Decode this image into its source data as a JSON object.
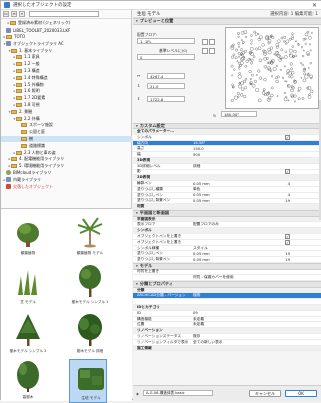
{
  "window": {
    "title": "選択したオブジェクトの設定",
    "close": "✕"
  },
  "toolbar": {
    "search_placeholder": ""
  },
  "tree": [
    {
      "label": "登録済み素材 (ジェネリック)",
      "indent": 6,
      "icon": "folder",
      "twist": "▸"
    },
    {
      "label": "LIBEL_TOOLBT_2020033.LKF",
      "indent": 2,
      "icon": "lib",
      "twist": ""
    },
    {
      "label": "TOTO",
      "indent": 2,
      "icon": "folder",
      "twist": "▸"
    },
    {
      "label": "オブジェクトライブラリ AC",
      "indent": 2,
      "icon": "lib",
      "twist": "▾"
    },
    {
      "label": "1. 基本ライブラリ",
      "indent": 7,
      "icon": "folder",
      "twist": "▾"
    },
    {
      "label": "1.1 家具",
      "indent": 12,
      "icon": "folder",
      "twist": "▸"
    },
    {
      "label": "1.2 一般",
      "indent": 12,
      "icon": "folder",
      "twist": "▸"
    },
    {
      "label": "1.3 構造",
      "indent": 12,
      "icon": "folder",
      "twist": "▸"
    },
    {
      "label": "1.4 特殊構造",
      "indent": 12,
      "icon": "folder",
      "twist": "▸"
    },
    {
      "label": "1.5 外構物",
      "indent": 12,
      "icon": "folder",
      "twist": "▸"
    },
    {
      "label": "1.6 照明",
      "indent": 12,
      "icon": "folder",
      "twist": "▸"
    },
    {
      "label": "1.7 2D要素",
      "indent": 12,
      "icon": "folder",
      "twist": "▸"
    },
    {
      "label": "1.8 可視",
      "indent": 12,
      "icon": "folder",
      "twist": "▸"
    },
    {
      "label": "2. 景観",
      "indent": 7,
      "icon": "folder",
      "twist": "▾"
    },
    {
      "label": "2.2 外構",
      "indent": 12,
      "icon": "folder",
      "twist": "▾"
    },
    {
      "label": "スポーツ施設",
      "indent": 17,
      "icon": "folder",
      "twist": ""
    },
    {
      "label": "公園と庭",
      "indent": 17,
      "icon": "folder",
      "twist": ""
    },
    {
      "label": "樹",
      "indent": 17,
      "icon": "folder",
      "twist": "",
      "selected": true
    },
    {
      "label": "道路標識",
      "indent": 17,
      "icon": "folder",
      "twist": ""
    },
    {
      "label": "2.3 人物と車の姿",
      "indent": 12,
      "icon": "folder",
      "twist": "▸"
    },
    {
      "label": "4. 配電機能用ライブラリ",
      "indent": 7,
      "icon": "folder",
      "twist": "▸"
    },
    {
      "label": "5. 環境機能用ライブラリ",
      "indent": 7,
      "icon": "folder",
      "twist": "▸"
    },
    {
      "label": "BIMcloudライブラリ",
      "indent": 2,
      "icon": "obj",
      "twist": ""
    },
    {
      "label": "内蔵ライブラリ",
      "indent": 2,
      "icon": "lib",
      "twist": "▸"
    },
    {
      "label": "欠落したオブジェクト",
      "indent": 2,
      "icon": "lib",
      "twist": "",
      "missing": true
    }
  ],
  "gallery": [
    {
      "label": "観葉植物",
      "kind": "bush"
    },
    {
      "label": "観葉植物 モデル",
      "kind": "palm"
    },
    {
      "label": "芝 モデル",
      "kind": "grass"
    },
    {
      "label": "樹木モデル シンプル 1",
      "kind": "tree"
    },
    {
      "label": "樹木モデル シンプル 2",
      "kind": "tree2"
    },
    {
      "label": "樹木モデル 詳細",
      "kind": "tree3"
    },
    {
      "label": "高樹木",
      "kind": "shrub"
    },
    {
      "label": "生垣 モデル",
      "kind": "hedge",
      "selected": true
    }
  ],
  "header": {
    "title": "生垣 モデル",
    "id_text": "選択内容: 1 編集可能: 1"
  },
  "sections": {
    "preview": "プレビューと位置",
    "custom": "カスタム設定",
    "floorplan": "平面図と断面図",
    "model": "モデル",
    "classification": "分類とプロパティ"
  },
  "preview": {
    "story_label": "配置フロア:",
    "story_value": "1. 1FL",
    "offset_label": "基準レベルに(0)",
    "offset_value": "0",
    "dim1": "4267.4",
    "dim2": "21.0",
    "dim3": "1722.8",
    "angle": "180.00°"
  },
  "param_head": {
    "name": "全てのパラメーター...",
    "value": ""
  },
  "params": [
    {
      "name": "シンボル",
      "value": "",
      "ctrl": "check",
      "grp": false
    },
    {
      "name": "幅方向",
      "value": "16.58°",
      "hl": true
    },
    {
      "name": "高さ",
      "value": "150.0"
    },
    {
      "name": "幅",
      "value": "500"
    },
    {
      "name": "3D表現",
      "value": "",
      "grp": true
    },
    {
      "name": "3D詳細レベル",
      "value": "詳細"
    },
    {
      "name": "影",
      "value": "",
      "ctrl": "check"
    },
    {
      "name": "2D表現",
      "value": "",
      "grp": true
    },
    {
      "name": "輪郭ペン",
      "value": "0.05 mm",
      "v3": "4"
    },
    {
      "name": "塗りつぶし種類",
      "value": "単色"
    },
    {
      "name": "塗りつぶしペン",
      "value": "0.05 mm",
      "v3": "4"
    },
    {
      "name": "塗りつぶし背景ペン",
      "value": "0.05 mm",
      "v3": "19"
    },
    {
      "name": "材質",
      "value": "",
      "grp": true
    }
  ],
  "floorplan": [
    {
      "name": "平面図表示",
      "value": "",
      "grp": true
    },
    {
      "name": "表示フロア",
      "value": "配置フロアのみ"
    },
    {
      "name": "シンボル",
      "value": "",
      "grp": true
    },
    {
      "name": "オブジェクトペンを上書き",
      "value": "",
      "ctrl": "check"
    },
    {
      "name": "オブジェクトペンを上書き",
      "value": "",
      "ctrl": "check"
    },
    {
      "name": "シンボル線種",
      "value": "スタイル"
    },
    {
      "name": "塗りつぶしペン",
      "value": "0.05 mm",
      "v3": "19"
    },
    {
      "name": "塗りつぶし背景ペン",
      "value": "0.05 mm",
      "v3": "19"
    }
  ],
  "model_rows": [
    {
      "name": "材質を上書き",
      "value": ""
    },
    {
      "name": "",
      "value": "材質 - 保護カバーを使用"
    }
  ],
  "class_rows": [
    {
      "name": "分類",
      "value": "",
      "grp": true
    },
    {
      "name": "ARCHICAD分類 - バージョン",
      "value": "植物",
      "hl": true
    },
    {
      "name": "",
      "value": "",
      "grp": false
    },
    {
      "name": "IDとカテゴリ",
      "value": "",
      "grp": true
    },
    {
      "name": "ID",
      "value": "09"
    },
    {
      "name": "構造機能",
      "value": "未定義"
    },
    {
      "name": "位置",
      "value": "未定義"
    },
    {
      "name": "リノベーション",
      "value": "",
      "grp": true
    },
    {
      "name": "リノベーションステータス",
      "value": "既存"
    },
    {
      "name": "リノベーションフィルタで表示",
      "value": "全ての新しい表示"
    },
    {
      "name": "施工情報",
      "value": "",
      "grp": true
    }
  ],
  "footer": {
    "layer": "A-G-06-構造体表 basic",
    "cancel": "キャンセル",
    "ok": "OK"
  }
}
